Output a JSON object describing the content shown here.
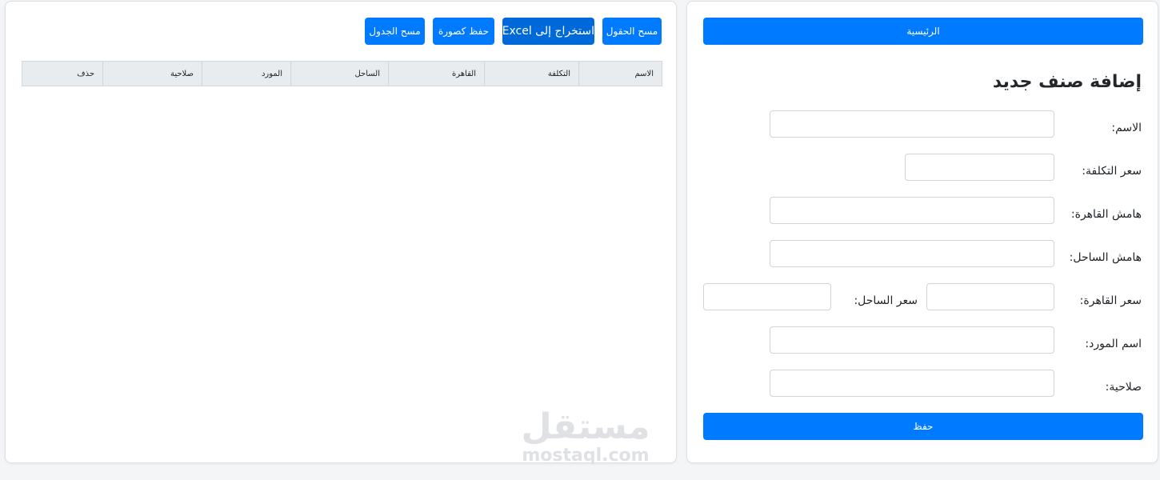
{
  "form": {
    "home_label": "الرئيسية",
    "title": "إضافة صنف جديد",
    "fields": {
      "name": {
        "label": "الاسم:",
        "value": ""
      },
      "cost": {
        "label": "سعر التكلفة:",
        "value": ""
      },
      "cairo_margin": {
        "label": "هامش القاهرة:",
        "value": ""
      },
      "coast_margin": {
        "label": "هامش الساحل:",
        "value": ""
      },
      "cairo_price": {
        "label": "سعر القاهرة:",
        "value": ""
      },
      "coast_price": {
        "label": "سعر الساحل:",
        "value": ""
      },
      "supplier": {
        "label": "اسم المورد:",
        "value": ""
      },
      "validity": {
        "label": "صلاحية:",
        "value": ""
      }
    },
    "save_label": "حفظ"
  },
  "toolbar": {
    "clear_fields": "مسح الحقول",
    "export_excel": "استخراج إلى Excel",
    "save_image": "حفظ كصورة",
    "clear_table": "مسح الجدول"
  },
  "table": {
    "headers": [
      "الاسم",
      "التكلفة",
      "القاهرة",
      "الساحل",
      "المورد",
      "صلاحية",
      "حذف"
    ],
    "rows": []
  },
  "watermark": {
    "logo": "مستقل",
    "text": "mostaql.com"
  },
  "colors": {
    "primary": "#007bff",
    "primary_dark": "#0069d9",
    "table_header_bg": "#e9ecef"
  }
}
